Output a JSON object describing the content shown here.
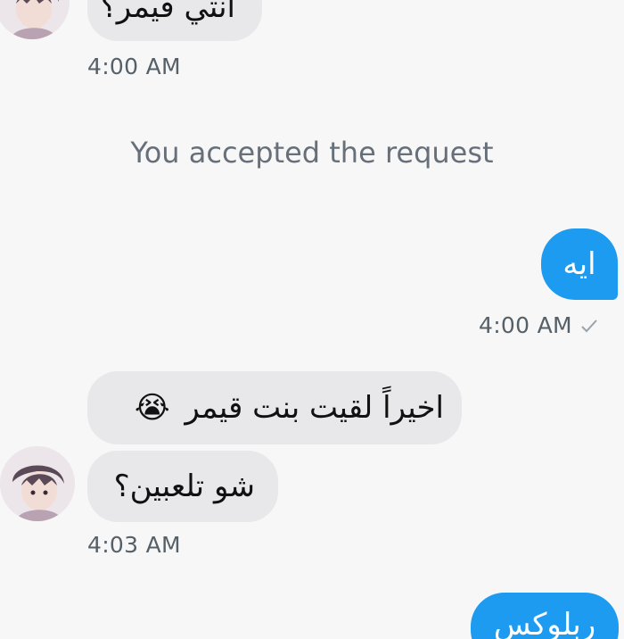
{
  "messages": {
    "m0": {
      "text": "انتي قيمر؟",
      "time": "4:00 AM"
    },
    "system": {
      "text": "You accepted the request"
    },
    "m1": {
      "text": "ايه",
      "time": "4:00 AM",
      "status_icon": "checkmark-icon"
    },
    "m2": {
      "text": "اخيراً لقيت بنت قيمر",
      "emoji": "😭"
    },
    "m3": {
      "text": "شو تلعبين؟",
      "time": "4:03 AM"
    },
    "m4": {
      "text": "ربلوكس"
    }
  },
  "colors": {
    "outgoing_bubble": "#1d9bf0",
    "incoming_bubble": "#e8e8ea",
    "background": "#f7f7f7",
    "timestamp": "#556068"
  }
}
